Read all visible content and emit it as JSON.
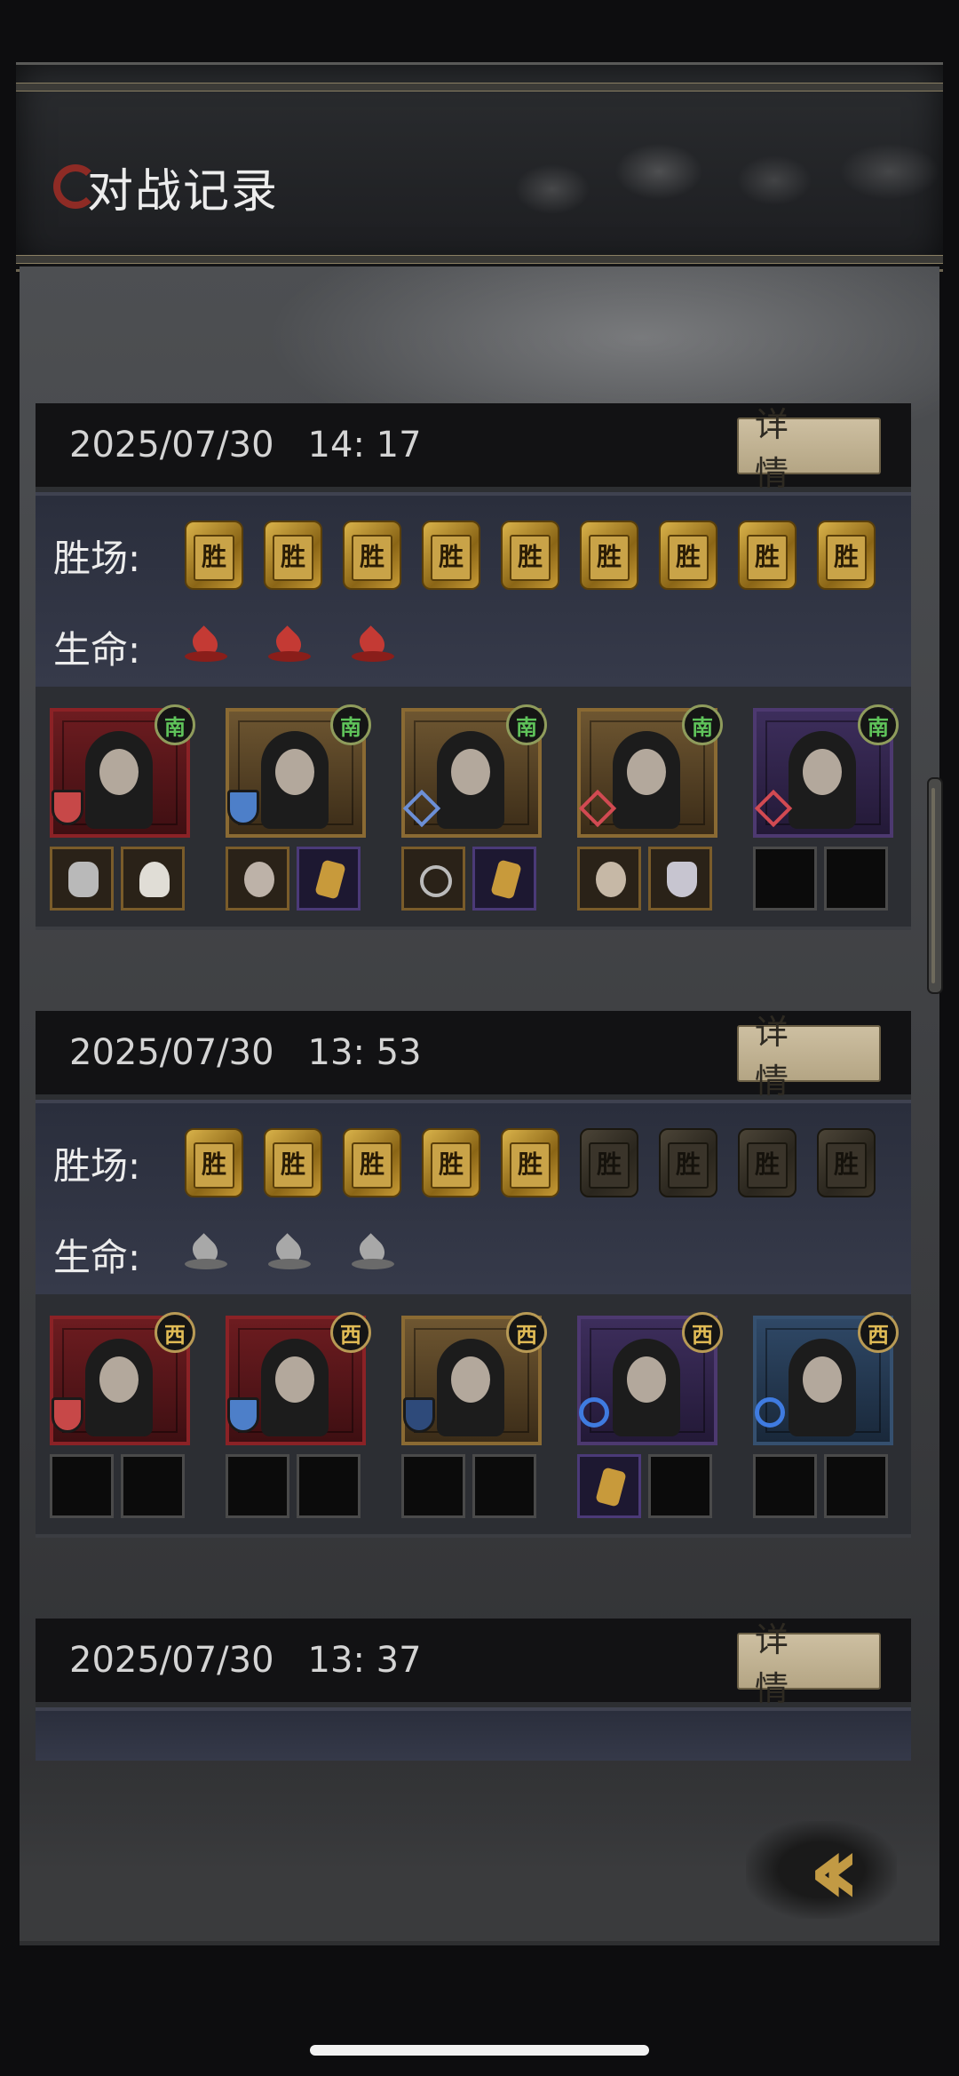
{
  "title": "对战记录",
  "detail_label": "详 情",
  "labels": {
    "wins": "胜场:",
    "life": "生命:"
  },
  "badge_text": "胜",
  "records": [
    {
      "date": "2025/07/30",
      "time": "14: 17",
      "wins": [
        true,
        true,
        true,
        true,
        true,
        true,
        true,
        true,
        true
      ],
      "life": [
        "red",
        "red",
        "red"
      ],
      "heroes": [
        {
          "seat": "南",
          "frame": "red",
          "role": "red",
          "items": [
            "bone",
            "lotus"
          ]
        },
        {
          "seat": "南",
          "frame": "gold",
          "role": "blue",
          "items": [
            "rabbit",
            "card"
          ]
        },
        {
          "seat": "南",
          "frame": "gold",
          "role": "diamond-blue",
          "items": [
            "ring",
            "card"
          ]
        },
        {
          "seat": "南",
          "frame": "gold",
          "role": "diamond-red",
          "items": [
            "orb",
            "bowl"
          ]
        },
        {
          "seat": "南",
          "frame": "purple",
          "role": "diamond-red",
          "items": [
            "",
            ""
          ]
        }
      ]
    },
    {
      "date": "2025/07/30",
      "time": "13: 53",
      "wins": [
        true,
        true,
        true,
        true,
        true,
        false,
        false,
        false,
        false
      ],
      "life": [
        "gray",
        "gray",
        "gray"
      ],
      "heroes": [
        {
          "seat": "西",
          "frame": "red",
          "role": "red",
          "items": [
            "",
            ""
          ]
        },
        {
          "seat": "西",
          "frame": "red",
          "role": "blue",
          "items": [
            "",
            ""
          ]
        },
        {
          "seat": "西",
          "frame": "gold",
          "role": "navy",
          "items": [
            "",
            ""
          ]
        },
        {
          "seat": "西",
          "frame": "purple",
          "role": "swirl",
          "items": [
            "card",
            ""
          ]
        },
        {
          "seat": "西",
          "frame": "blue",
          "role": "swirl",
          "items": [
            "",
            ""
          ]
        }
      ]
    },
    {
      "date": "2025/07/30",
      "time": "13: 37"
    }
  ]
}
